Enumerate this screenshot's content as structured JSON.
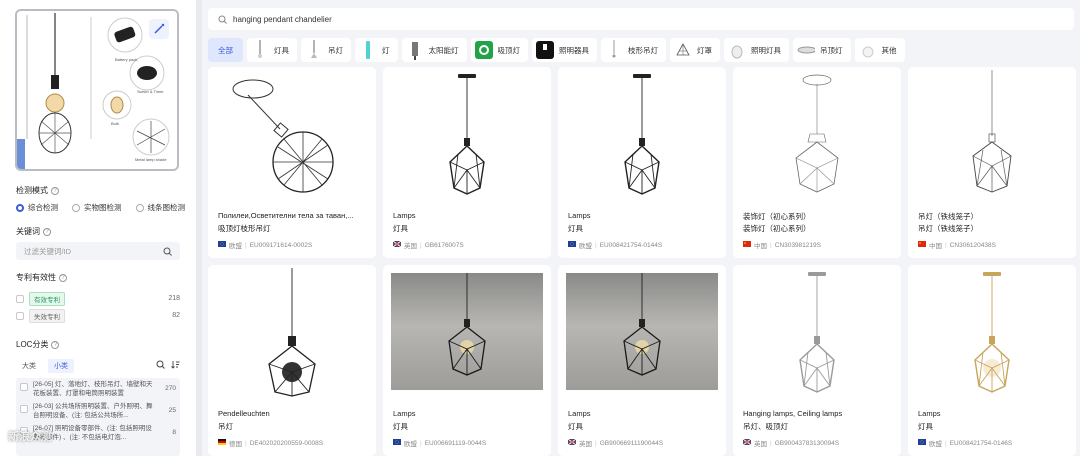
{
  "sidebar": {
    "detect_mode_label": "检测模式",
    "detect_modes": [
      "综合检测",
      "实物图检测",
      "线条图检测"
    ],
    "keyword_label": "关键词",
    "keyword_placeholder": "过滤关键词/ID",
    "validity_label": "专利有效性",
    "validity_items": [
      {
        "label": "有效专利",
        "count": "218"
      },
      {
        "label": "失效专利",
        "count": "82"
      }
    ],
    "loc_label": "LOC分类",
    "loc_tabs": [
      "大类",
      "小类"
    ],
    "loc_items": [
      {
        "text": "[26-05] 灯、落地灯、枝形吊灯、墙壁和天花板装置、灯罩和电筒照明装置",
        "count": "270"
      },
      {
        "text": "[26-03] 公共场所照明装置、户外照明、舞台照明设备、(注: 包括公共场所...",
        "count": "25"
      },
      {
        "text": "[26-07] 照明设备零部件、(注: 包括照明设备零部件) 、(注: 不包括电灯泡...",
        "count": "8"
      }
    ],
    "upload_labels": [
      "Battery pack",
      "Switch & Timer",
      "Bulb",
      "Metal lamp shade"
    ],
    "watermark": "新浪众测"
  },
  "search": {
    "value": "hanging pendant chandelier"
  },
  "categories": [
    "全部",
    "灯具",
    "吊灯",
    "灯",
    "太阳能灯",
    "吸顶灯",
    "照明器具",
    "枝形吊灯",
    "灯罩",
    "照明灯具",
    "吊顶灯",
    "其他"
  ],
  "results": [
    {
      "t1": "Полилеи,Осветителни тела за таван,...",
      "t2": "吸顶灯枝形吊灯",
      "country": "欧盟",
      "id": "EU009171614-0002S",
      "flag": "eu",
      "img": "sketch-ball"
    },
    {
      "t1": "Lamps",
      "t2": "灯具",
      "country": "英国",
      "id": "GB6176007S",
      "flag": "gb",
      "img": "cage-dark"
    },
    {
      "t1": "Lamps",
      "t2": "灯具",
      "country": "欧盟",
      "id": "EU008421754-0144S",
      "flag": "eu",
      "img": "cage-dark"
    },
    {
      "t1": "装饰灯（初心系列）",
      "t2": "装饰灯（初心系列）",
      "country": "中国",
      "id": "CN303981219S",
      "flag": "cn",
      "img": "sketch-gem"
    },
    {
      "t1": "吊灯（铁线笼子）",
      "t2": "吊灯（铁线笼子）",
      "country": "中国",
      "id": "CN306120438S",
      "flag": "cn",
      "img": "sketch-cage"
    },
    {
      "t1": "Pendelleuchten",
      "t2": "吊灯",
      "country": "德国",
      "id": "DE402020200559-0008S",
      "flag": "de",
      "img": "cage-bulb"
    },
    {
      "t1": "Lamps",
      "t2": "灯具",
      "country": "欧盟",
      "id": "EU006691119-0044S",
      "flag": "eu",
      "img": "photo"
    },
    {
      "t1": "Lamps",
      "t2": "灯具",
      "country": "英国",
      "id": "GB90066911190044S",
      "flag": "gb",
      "img": "photo"
    },
    {
      "t1": "Hanging lamps, Ceiling lamps",
      "t2": "吊灯、吸顶灯",
      "country": "英国",
      "id": "GB90043783130094S",
      "flag": "gb",
      "img": "cage-silver"
    },
    {
      "t1": "Lamps",
      "t2": "灯具",
      "country": "欧盟",
      "id": "EU008421754-0146S",
      "flag": "eu",
      "img": "cage-gold"
    }
  ]
}
